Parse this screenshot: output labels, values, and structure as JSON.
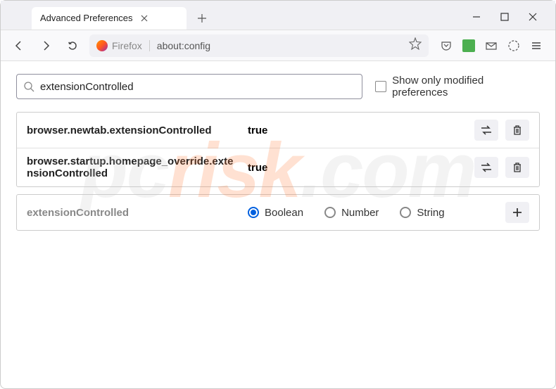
{
  "window": {
    "tab_title": "Advanced Preferences"
  },
  "urlbar": {
    "badge": "Firefox",
    "url": "about:config"
  },
  "search": {
    "value": "extensionControlled",
    "checkbox_label": "Show only modified preferences"
  },
  "prefs": [
    {
      "name": "browser.newtab.extensionControlled",
      "value": "true"
    },
    {
      "name": "browser.startup.homepage_override.extensionControlled",
      "value": "true"
    }
  ],
  "new_pref": {
    "name": "extensionControlled",
    "type_boolean": "Boolean",
    "type_number": "Number",
    "type_string": "String"
  },
  "watermark": {
    "p": "pc",
    "r": "risk",
    "c": ".com"
  }
}
